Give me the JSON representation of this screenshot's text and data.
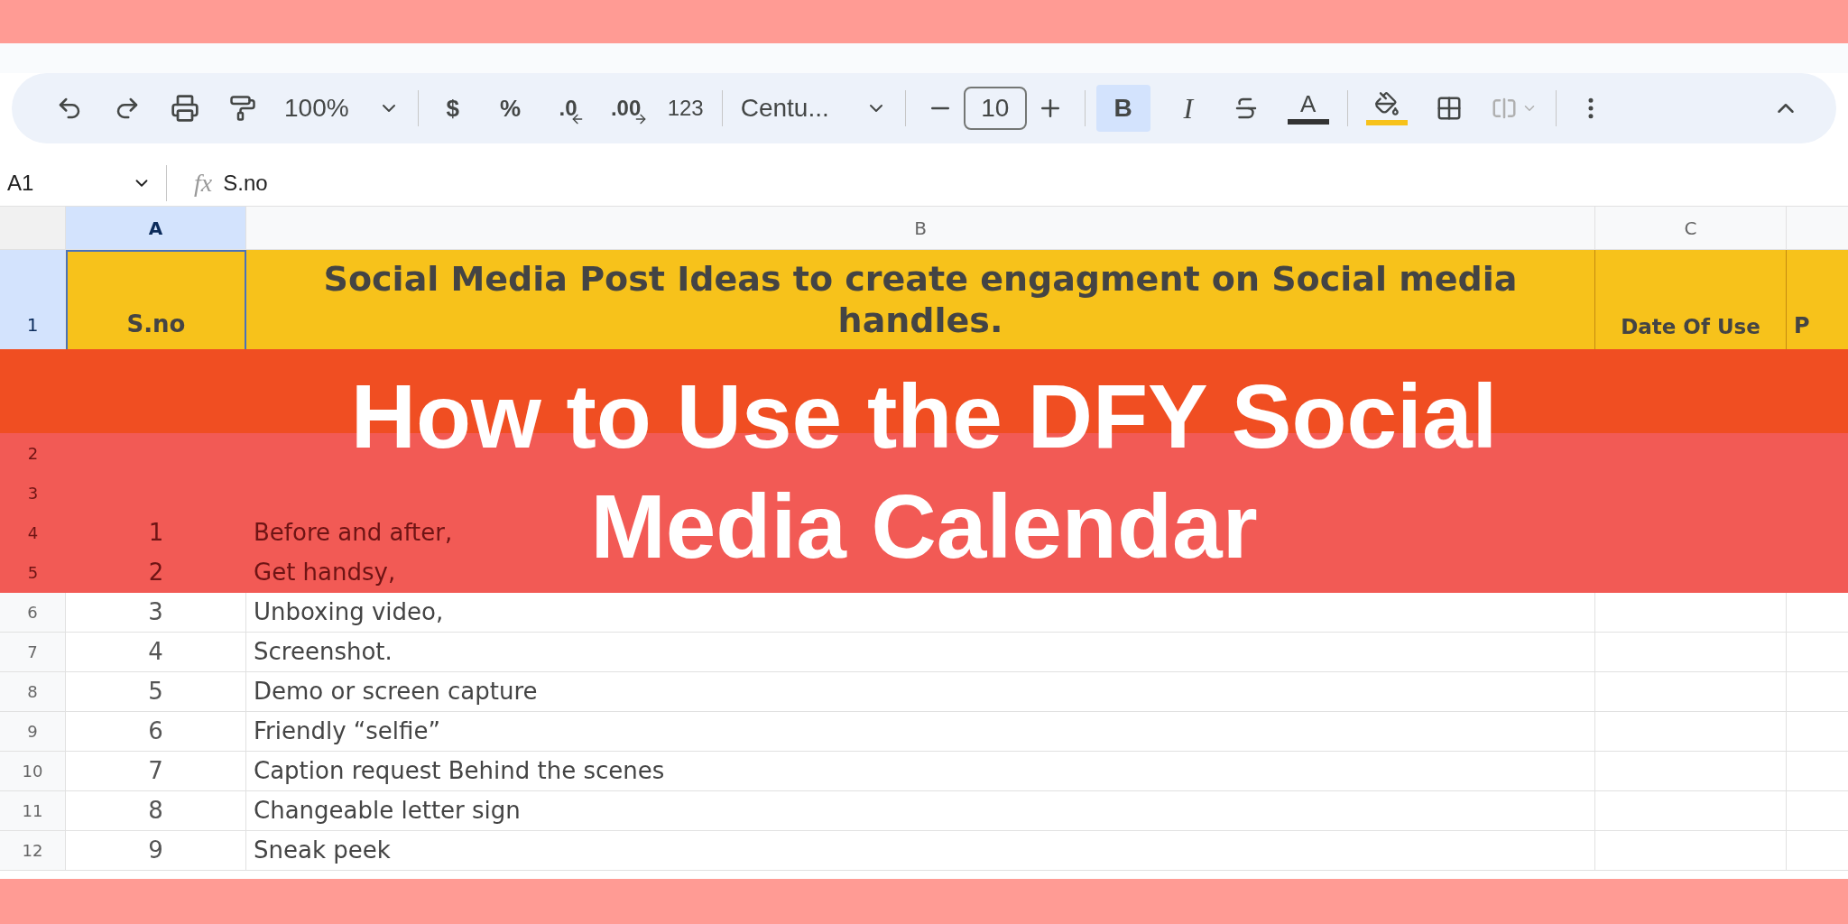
{
  "toolbar": {
    "zoom": "100%",
    "currency": "$",
    "percent": "%",
    "decrease_decimal": ".0",
    "increase_decimal": ".00",
    "number_format": "123",
    "font": "Centu...",
    "font_size": "10",
    "bold": "B",
    "bold_on": true,
    "italic": "I",
    "text_color": "A"
  },
  "formula_bar": {
    "cell": "A1",
    "fx": "fx",
    "value": "S.no"
  },
  "columns": [
    {
      "label": "A",
      "selected": true
    },
    {
      "label": "B",
      "selected": false
    },
    {
      "label": "C",
      "selected": false
    }
  ],
  "header_row": {
    "number": "1",
    "sno": "S.no",
    "title": "Social Media Post Ideas to create engagment on Social media handles.",
    "date": "Date Of Use",
    "column_4": "P"
  },
  "section_rows": [
    {
      "number": "2"
    },
    {
      "number": "3"
    }
  ],
  "rows": [
    {
      "number": "4",
      "sno": "1",
      "idea": "Before and after,"
    },
    {
      "number": "5",
      "sno": "2",
      "idea": "Get handsy,"
    },
    {
      "number": "6",
      "sno": "3",
      "idea": "Unboxing video,"
    },
    {
      "number": "7",
      "sno": "4",
      "idea": "Screenshot."
    },
    {
      "number": "8",
      "sno": "5",
      "idea": "Demo or screen capture"
    },
    {
      "number": "9",
      "sno": "6",
      "idea": "Friendly “selfie”"
    },
    {
      "number": "10",
      "sno": "7",
      "idea": "Caption request Behind the scenes"
    },
    {
      "number": "11",
      "sno": "8",
      "idea": "Changeable letter sign"
    },
    {
      "number": "12",
      "sno": "9",
      "idea": "Sneak peek"
    }
  ],
  "banner": {
    "title_lines": [
      "How to Use the DFY Social",
      "Media Calendar"
    ]
  }
}
